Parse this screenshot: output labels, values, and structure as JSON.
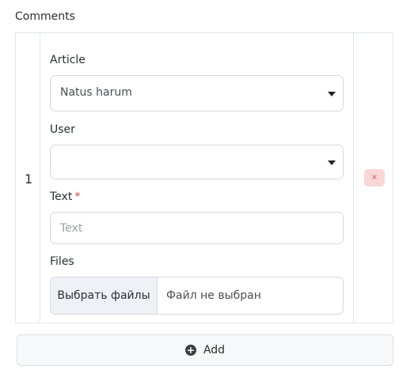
{
  "section": {
    "title": "Comments"
  },
  "row": {
    "index": "1",
    "remove_icon": "×",
    "article": {
      "label": "Article",
      "value": "Natus harum"
    },
    "user": {
      "label": "User",
      "value": ""
    },
    "text": {
      "label": "Text",
      "required_mark": "*",
      "placeholder": "Text",
      "value": ""
    },
    "files": {
      "label": "Files",
      "button_label": "Выбрать файлы",
      "status": "Файл не выбран"
    }
  },
  "add_button": {
    "label": "Add",
    "icon": "+"
  },
  "colors": {
    "remove_bg": "#f9d7d7",
    "remove_fg": "#d9534f",
    "required": "#e0433f",
    "border": "#d6d9dd"
  }
}
